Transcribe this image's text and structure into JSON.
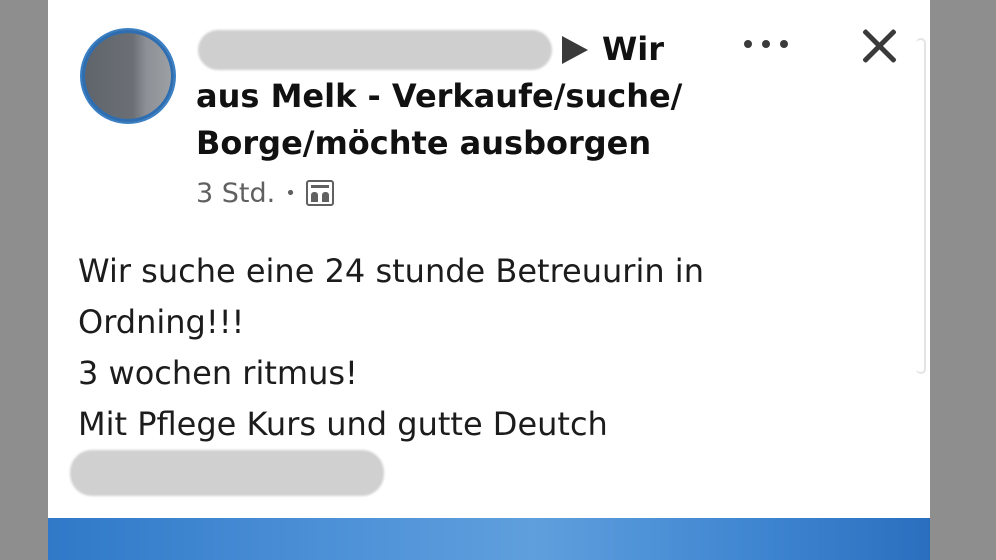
{
  "post": {
    "title_line1": "Wir",
    "title_line2": "aus Melk - Verkaufe/suche/",
    "title_line3": "Borge/möchte ausborgen",
    "time": "3 Std.",
    "separator": "•",
    "body_lines": [
      "Wir suche eine 24 stunde Betreuurin in",
      "Ordning!!!",
      "3 wochen ritmus!",
      "Mit Pflege Kurs und gutte Deutch"
    ]
  },
  "icons": {
    "arrow": "arrow-right-icon",
    "more": "more-options-icon",
    "close": "close-icon",
    "group": "group-audience-icon"
  },
  "colors": {
    "card_background": "#ffffff",
    "side_background": "#8e8e8e",
    "text": "#1c1c1c",
    "meta_text": "#606060",
    "image_blue": "#3f86d1"
  }
}
